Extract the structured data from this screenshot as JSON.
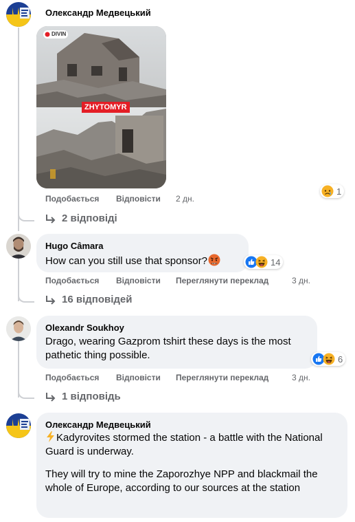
{
  "comments": [
    {
      "author": "Олександр Медвецький",
      "image_label": "ZHYTOMYR",
      "image_tag": "DIVIN",
      "actions": {
        "like": "Подобається",
        "reply": "Відповісти"
      },
      "time": "2 дн.",
      "reactions": {
        "count": "1",
        "icons": [
          "sad-icon"
        ]
      },
      "replies_label": "2 відповіді"
    },
    {
      "author": "Hugo Câmara",
      "text": "How can you still use that sponsor?",
      "actions": {
        "like": "Подобається",
        "reply": "Відповісти",
        "translate": "Переглянути переклад"
      },
      "time": "3 дн.",
      "reactions": {
        "count": "14",
        "icons": [
          "like-icon",
          "haha-icon"
        ]
      },
      "replies_label": "16 відповідей"
    },
    {
      "author": "Olexandr Soukhoy",
      "text": "Drago, wearing Gazprom tshirt these days is the most pathetic thing possible.",
      "actions": {
        "like": "Подобається",
        "reply": "Відповісти",
        "translate": "Переглянути переклад"
      },
      "time": "3 дн.",
      "reactions": {
        "count": "6",
        "icons": [
          "like-icon",
          "haha-icon"
        ]
      },
      "replies_label": "1 відповідь"
    },
    {
      "author": "Олександр Медвецький",
      "text_p1": "Kadyrovites stormed the station - a battle with the National Guard is underway.",
      "text_p2": "They will try to mine the Zaporozhye NPP and blackmail the whole of Europe, according to our sources at the station"
    }
  ],
  "colors": {
    "bubble": "#f0f2f5",
    "secondary_text": "#65676b",
    "like_blue": "#1877f2",
    "haha_yellow": "#f7b125"
  }
}
